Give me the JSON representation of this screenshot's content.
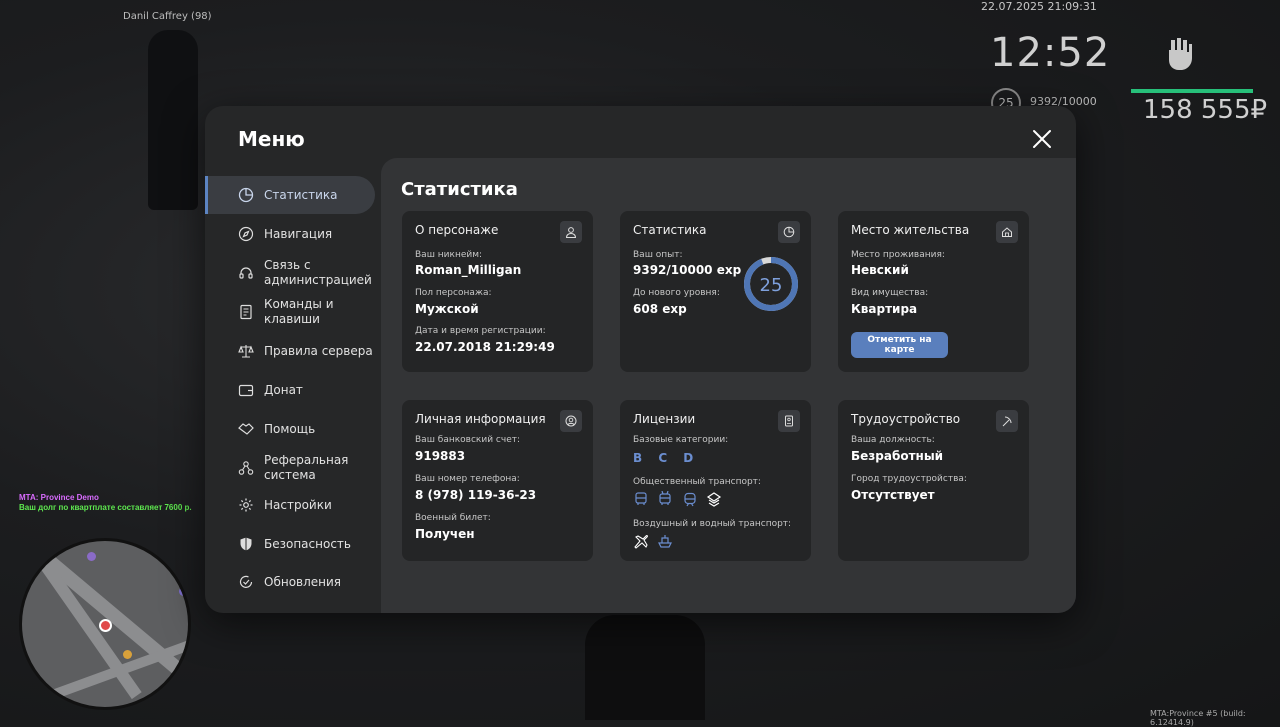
{
  "hud": {
    "datetime": "22.07.2025 21:09:31",
    "player_nick": "Danil Caffrey (98)",
    "clock": "12:52",
    "level": "25",
    "exp": "9392/10000",
    "money": "158 555₽",
    "chat": [
      "MTA: Province Demo",
      "Ваш долг по квартплате составляет 7600 р."
    ],
    "build": "MTA:Province #5 (build: 6.12414.9)"
  },
  "menu": {
    "title": "Меню",
    "accent": "#5c84c2",
    "nav": [
      {
        "label": "Статистика",
        "icon": "pie-chart-icon"
      },
      {
        "label": "Навигация",
        "icon": "compass-icon"
      },
      {
        "label": "Связь с администрацией",
        "icon": "headset-icon"
      },
      {
        "label": "Команды и клавиши",
        "icon": "document-icon"
      },
      {
        "label": "Правила сервера",
        "icon": "scales-icon"
      },
      {
        "label": "Донат",
        "icon": "wallet-icon"
      },
      {
        "label": "Помощь",
        "icon": "handshake-icon"
      },
      {
        "label": "Реферальная система",
        "icon": "network-icon"
      },
      {
        "label": "Настройки",
        "icon": "gear-icon"
      },
      {
        "label": "Безопасность",
        "icon": "shield-icon"
      },
      {
        "label": "Обновления",
        "icon": "refresh-check-icon"
      }
    ]
  },
  "stats": {
    "title": "Статистика",
    "character": {
      "title": "О персонаже",
      "nickname_label": "Ваш никнейм:",
      "nickname": "Roman_Milligan",
      "gender_label": "Пол персонажа:",
      "gender": "Мужской",
      "reg_label": "Дата и время регистрации:",
      "reg": "22.07.2018 21:29:49"
    },
    "statistics": {
      "title": "Статистика",
      "exp_label": "Ваш опыт:",
      "exp": "9392/10000 exp",
      "next_label": "До нового уровня:",
      "next": "608 exp",
      "level": "25",
      "progress": 0.9392
    },
    "residence": {
      "title": "Место жительства",
      "place_label": "Место проживания:",
      "place": "Невский",
      "type_label": "Вид имущества:",
      "type": "Квартира",
      "button": "Отметить на карте"
    },
    "personal": {
      "title": "Личная информация",
      "bank_label": "Ваш банковский счет:",
      "bank": "919883",
      "phone_label": "Ваш номер телефона:",
      "phone": "8 (978) 119-36-23",
      "military_label": "Военный билет:",
      "military": "Получен"
    },
    "licenses": {
      "title": "Лицензии",
      "base_label": "Базовые категории:",
      "base": "B C D",
      "public_label": "Общественный транспорт:",
      "air_label": "Воздушный и водный транспорт:"
    },
    "employment": {
      "title": "Трудоустройство",
      "position_label": "Ваша должность:",
      "position": "Безработный",
      "city_label": "Город трудоустройства:",
      "city": "Отсутствует"
    }
  }
}
